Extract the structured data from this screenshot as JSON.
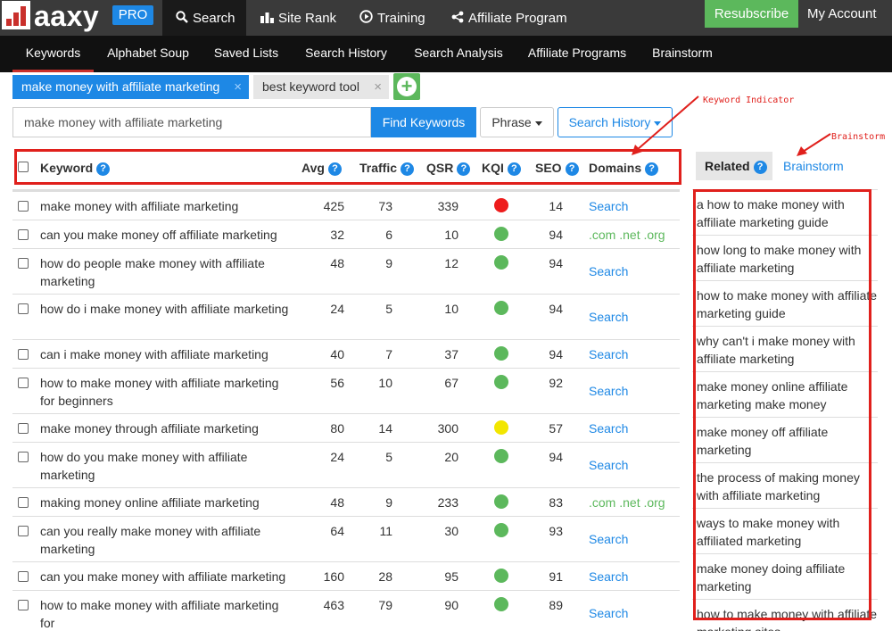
{
  "app": {
    "logo_text": "aaxy",
    "pro_label": "PRO",
    "top_nav": [
      {
        "label": "Search",
        "icon": "search-icon"
      },
      {
        "label": "Site Rank",
        "icon": "bar-chart-icon"
      },
      {
        "label": "Training",
        "icon": "play-circle-icon"
      },
      {
        "label": "Affiliate Program",
        "icon": "share-icon"
      }
    ],
    "resubscribe_label": "Resubscribe",
    "my_account_label": "My Account",
    "sub_nav": [
      "Keywords",
      "Alphabet Soup",
      "Saved Lists",
      "Search History",
      "Search Analysis",
      "Affiliate Programs",
      "Brainstorm"
    ]
  },
  "tags": [
    {
      "label": "make money with affiliate marketing",
      "close": "×"
    },
    {
      "label": "best keyword tool",
      "close": "×"
    }
  ],
  "search": {
    "value": "make money with affiliate marketing",
    "find_label": "Find Keywords",
    "phrase_label": "Phrase",
    "history_label": "Search History"
  },
  "table": {
    "headers": {
      "keyword": "Keyword",
      "avg": "Avg",
      "traffic": "Traffic",
      "qsr": "QSR",
      "kqi": "KQI",
      "seo": "SEO",
      "domains": "Domains"
    },
    "help_glyph": "?",
    "colors": {
      "red": "#ee1c1c",
      "green": "#5cb85c",
      "yellow": "#f2e600"
    },
    "rows": [
      {
        "keyword": "make money with affiliate marketing",
        "avg": "425",
        "traffic": "73",
        "qsr": "339",
        "kqi": "red",
        "seo": "14",
        "domains": "Search"
      },
      {
        "keyword": "can you make money off affiliate marketing",
        "avg": "32",
        "traffic": "6",
        "qsr": "10",
        "kqi": "green",
        "seo": "94",
        "domains": ".com .net .org"
      },
      {
        "keyword": "how do people make money with affiliate marketing",
        "avg": "48",
        "traffic": "9",
        "qsr": "12",
        "kqi": "green",
        "seo": "94",
        "domains": "Search"
      },
      {
        "keyword": "how do i make money with affiliate marketing",
        "avg": "24",
        "traffic": "5",
        "qsr": "10",
        "kqi": "green",
        "seo": "94",
        "domains": "Search"
      },
      {
        "keyword": "can i make money with affiliate marketing",
        "avg": "40",
        "traffic": "7",
        "qsr": "37",
        "kqi": "green",
        "seo": "94",
        "domains": "Search"
      },
      {
        "keyword": "how to make money with affiliate marketing for beginners",
        "avg": "56",
        "traffic": "10",
        "qsr": "67",
        "kqi": "green",
        "seo": "92",
        "domains": "Search"
      },
      {
        "keyword": "make money through affiliate marketing",
        "avg": "80",
        "traffic": "14",
        "qsr": "300",
        "kqi": "yellow",
        "seo": "57",
        "domains": "Search"
      },
      {
        "keyword": "how do you make money with affiliate marketing",
        "avg": "24",
        "traffic": "5",
        "qsr": "20",
        "kqi": "green",
        "seo": "94",
        "domains": "Search"
      },
      {
        "keyword": "making money online affiliate marketing",
        "avg": "48",
        "traffic": "9",
        "qsr": "233",
        "kqi": "green",
        "seo": "83",
        "domains": ".com .net .org"
      },
      {
        "keyword": "can you really make money with affiliate marketing",
        "avg": "64",
        "traffic": "11",
        "qsr": "30",
        "kqi": "green",
        "seo": "93",
        "domains": "Search"
      },
      {
        "keyword": "can you make money with affiliate marketing",
        "avg": "160",
        "traffic": "28",
        "qsr": "95",
        "kqi": "green",
        "seo": "91",
        "domains": "Search"
      },
      {
        "keyword": "how to make money with affiliate marketing for",
        "avg": "463",
        "traffic": "79",
        "qsr": "90",
        "kqi": "green",
        "seo": "89",
        "domains": "Search"
      }
    ]
  },
  "right_panel": {
    "tab_related": "Related",
    "tab_brainstorm": "Brainstorm",
    "items": [
      "a how to make money with affiliate marketing guide",
      "how long to make money with affiliate marketing",
      "how to make money with affiliate marketing guide",
      "why can't i make money with affiliate marketing",
      "make money online affiliate marketing make money",
      "make money off affiliate marketing",
      "the process of making money with affiliate marketing",
      "ways to make money with affiliated marketing",
      "make money doing affiliate marketing",
      "how to make money with affiliate marketing sites"
    ]
  },
  "annotations": {
    "keyword_indicator": "Keyword Indicator",
    "brainstorm": "Brainstorm"
  }
}
